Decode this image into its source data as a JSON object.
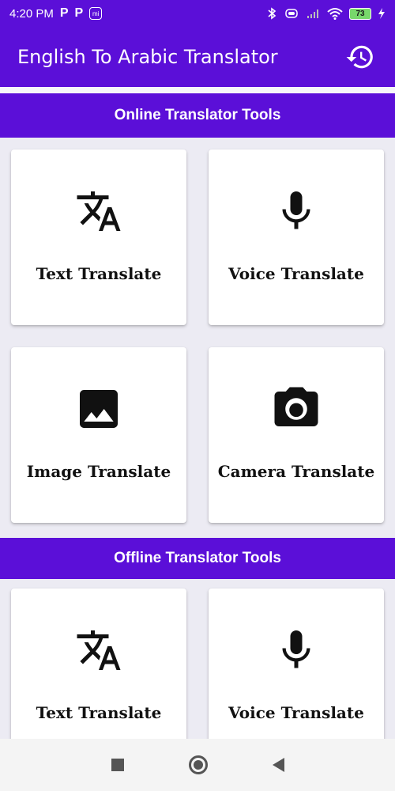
{
  "status_bar": {
    "time": "4:20 PM",
    "p1": "P",
    "p2": "P",
    "mi": "mi",
    "battery": "73"
  },
  "app_bar": {
    "title": "English To Arabic Translator",
    "history_icon": "history-icon"
  },
  "sections": {
    "online": {
      "title": "Online Translator Tools",
      "cards": [
        {
          "label": "Text Translate",
          "icon": "translate-icon"
        },
        {
          "label": "Voice Translate",
          "icon": "mic-icon"
        },
        {
          "label": "Image Translate",
          "icon": "image-icon"
        },
        {
          "label": "Camera Translate",
          "icon": "camera-icon"
        }
      ]
    },
    "offline": {
      "title": "Offline Translator Tools",
      "cards": [
        {
          "label": "Text Translate",
          "icon": "translate-icon"
        },
        {
          "label": "Voice Translate",
          "icon": "mic-icon"
        }
      ]
    }
  },
  "colors": {
    "primary": "#5b0fd8",
    "background": "#ecebf3"
  }
}
